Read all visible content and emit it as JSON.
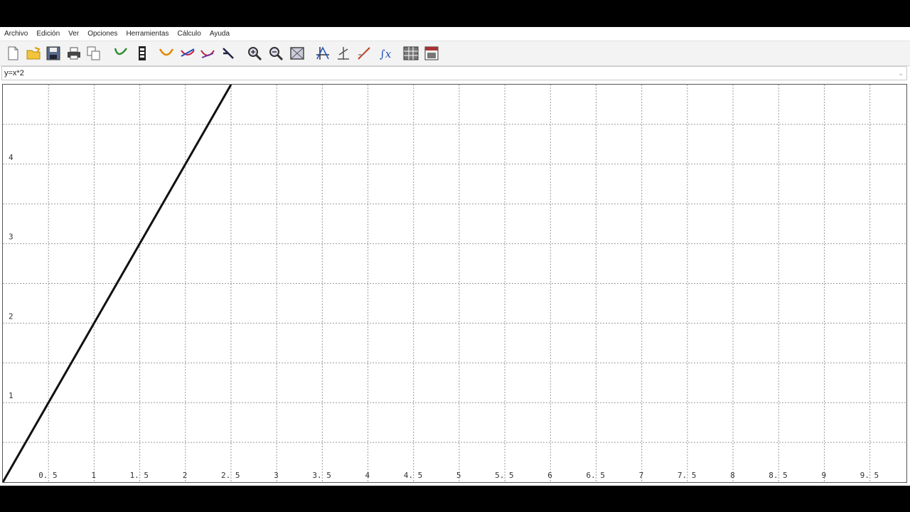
{
  "menu": [
    "Archivo",
    "Edición",
    "Ver",
    "Opciones",
    "Herramientas",
    "Cálculo",
    "Ayuda"
  ],
  "toolbar": [
    {
      "icon": "new-file-icon"
    },
    {
      "icon": "open-folder-icon"
    },
    {
      "icon": "save-icon"
    },
    {
      "icon": "print-icon"
    },
    {
      "icon": "copy-icon"
    },
    {
      "icon": "curve-icon"
    },
    {
      "icon": "table-icon"
    },
    {
      "icon": "parabola-icon"
    },
    {
      "icon": "intersection-icon"
    },
    {
      "icon": "tangent-icon"
    },
    {
      "icon": "point-icon"
    },
    {
      "icon": "zoom-in-icon"
    },
    {
      "icon": "zoom-out-icon"
    },
    {
      "icon": "zoom-window-icon"
    },
    {
      "icon": "axes-icon"
    },
    {
      "icon": "angle-icon"
    },
    {
      "icon": "line-icon"
    },
    {
      "icon": "integral-icon"
    },
    {
      "icon": "grid-calc-icon"
    },
    {
      "icon": "window-icon"
    }
  ],
  "expression": {
    "value": "y=x*2"
  },
  "chart_data": {
    "type": "line",
    "xlim": [
      0,
      9.9
    ],
    "ylim": [
      0,
      5
    ],
    "x_ticks": [
      "0.5",
      "1",
      "1.5",
      "2",
      "2.5",
      "3",
      "3.5",
      "4",
      "4.5",
      "5",
      "5.5",
      "6",
      "6.5",
      "7",
      "7.5",
      "8",
      "8.5",
      "9",
      "9.5"
    ],
    "y_ticks": [
      "1",
      "2",
      "3",
      "4"
    ],
    "grid": true,
    "series": [
      {
        "x": [
          0,
          2.5
        ],
        "y": [
          0,
          5
        ],
        "color": "#111111"
      }
    ]
  }
}
